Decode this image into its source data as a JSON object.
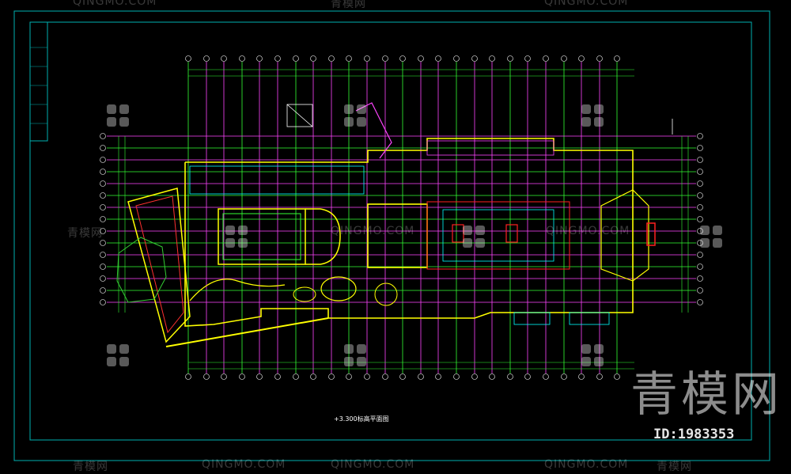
{
  "drawing": {
    "title": "+3.300标高平面图",
    "colors": {
      "background": "#000000",
      "frame": "#00b0b0",
      "grid": "#ff44ff",
      "axis": "#33ff33",
      "wall": "#ffff00",
      "accent": "#ff2020",
      "interior": "#00ffff"
    }
  },
  "watermark": {
    "brand": "青模网",
    "id_text": "ID:1983353",
    "tiles": [
      "QINGMO.COM",
      "青模网",
      "QINGMO.COM",
      "青模网",
      "QINGMO.COM",
      "QINGMO.COM",
      "青模网",
      "QINGMO.COM",
      "QINGMO.COM",
      "QINGMO.COM",
      "青模网"
    ]
  }
}
